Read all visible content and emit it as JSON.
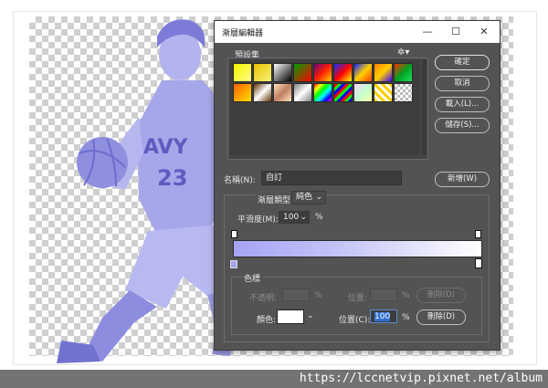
{
  "dialog": {
    "title": "漸層編輯器",
    "presets_label": "預設集",
    "presets_menu_icon": "gear-icon",
    "buttons": {
      "ok": "確定",
      "cancel": "取消",
      "load": "載入(L)...",
      "save": "儲存(S)..."
    },
    "name_label": "名稱(N):",
    "name_value": "自訂",
    "new_button": "新增(W)",
    "gradient_type_label": "漸層類型:",
    "gradient_type_value": "純色",
    "smoothness_label": "平滑度(M):",
    "smoothness_value": "100",
    "smoothness_unit": "%",
    "stops_group_label": "色標",
    "opacity_label": "不透明:",
    "opacity_unit": "%",
    "opacity_location_label": "位置:",
    "opacity_location_unit": "%",
    "opacity_delete": "刪除(D)",
    "color_label": "顏色:",
    "color_swatch": "#ffffff",
    "color_location_label": "位置(C):",
    "color_location_value": "100",
    "color_location_unit": "%",
    "color_delete": "刪除(D)",
    "gradient_colors": [
      "#a5a4f4",
      "#ffffff"
    ]
  },
  "window_controls": {
    "minimize": "—",
    "maximize": "☐",
    "close": "✕"
  },
  "watermark": "https://lccnetvip.pixnet.net/album"
}
